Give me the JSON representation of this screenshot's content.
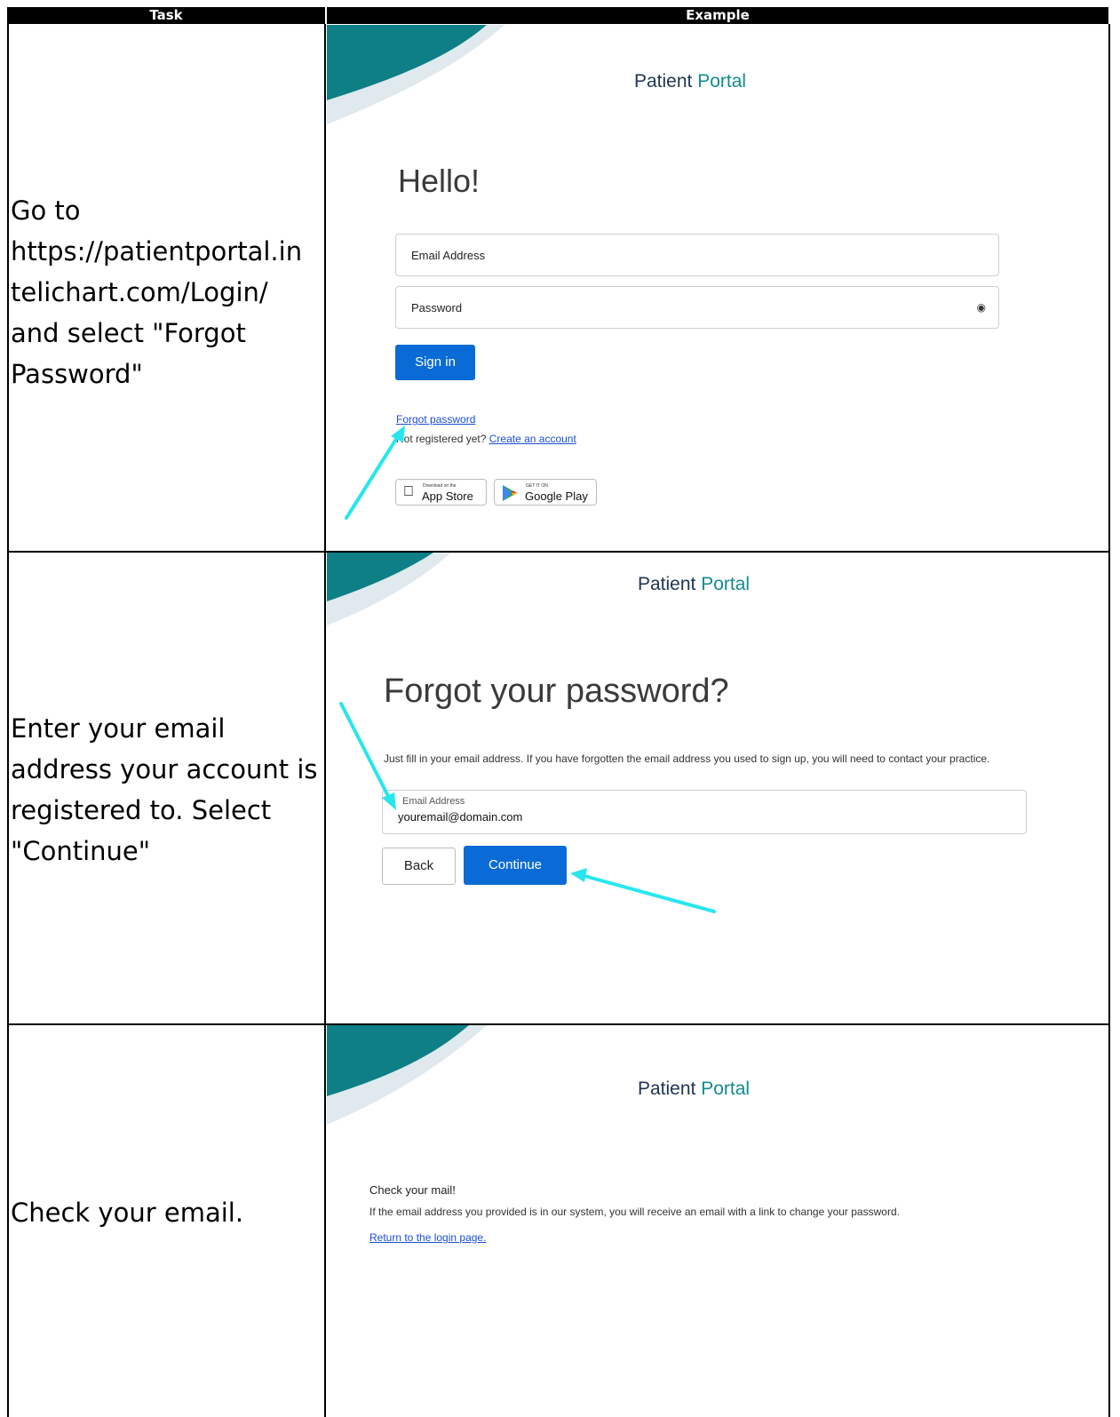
{
  "table": {
    "header_task": "Task",
    "header_example": "Example"
  },
  "rows": [
    {
      "task_lines": [
        "Go to",
        "https://patientportal.in",
        "telichart.com/Login/",
        "and select \"Forgot",
        "Password\""
      ],
      "screen": {
        "brand": {
          "word1": "Patient",
          "word2": "Portal"
        },
        "heading": "Hello!",
        "email_placeholder": "Email Address",
        "password_placeholder": "Password",
        "eye_icon": "eye-icon",
        "sign_in_label": "Sign in",
        "forgot_link": "Forgot password",
        "not_registered": "Not registered yet?",
        "create_account_link": "Create an account",
        "app_store": {
          "small": "Download on the",
          "big": "App Store"
        },
        "google_play": {
          "small": "GET IT ON",
          "big": "Google Play"
        }
      }
    },
    {
      "task_lines": [
        "Enter your email",
        "address your account is",
        "registered to. Select",
        "\"Continue\""
      ],
      "screen": {
        "brand": {
          "word1": "Patient",
          "word2": "Portal"
        },
        "heading": "Forgot your password?",
        "instructions": "Just fill in your email address. If you have forgotten the email address you used to sign up, you will need to contact your practice.",
        "email_label": "Email Address",
        "email_value": "youremail@domain.com",
        "back_label": "Back",
        "continue_label": "Continue"
      }
    },
    {
      "task_lines": [
        "Check your email."
      ],
      "screen": {
        "brand": {
          "word1": "Patient",
          "word2": "Portal"
        },
        "title": "Check your mail!",
        "body": "If the email address you provided is in our system, you will receive an email with a link to change your password.",
        "return_link": "Return to the login page."
      }
    }
  ],
  "colors": {
    "brand_navy": "#1f3553",
    "brand_teal": "#148c8c",
    "primary_button": "#0b6bd6",
    "annotation_arrow": "#27e6ee"
  }
}
